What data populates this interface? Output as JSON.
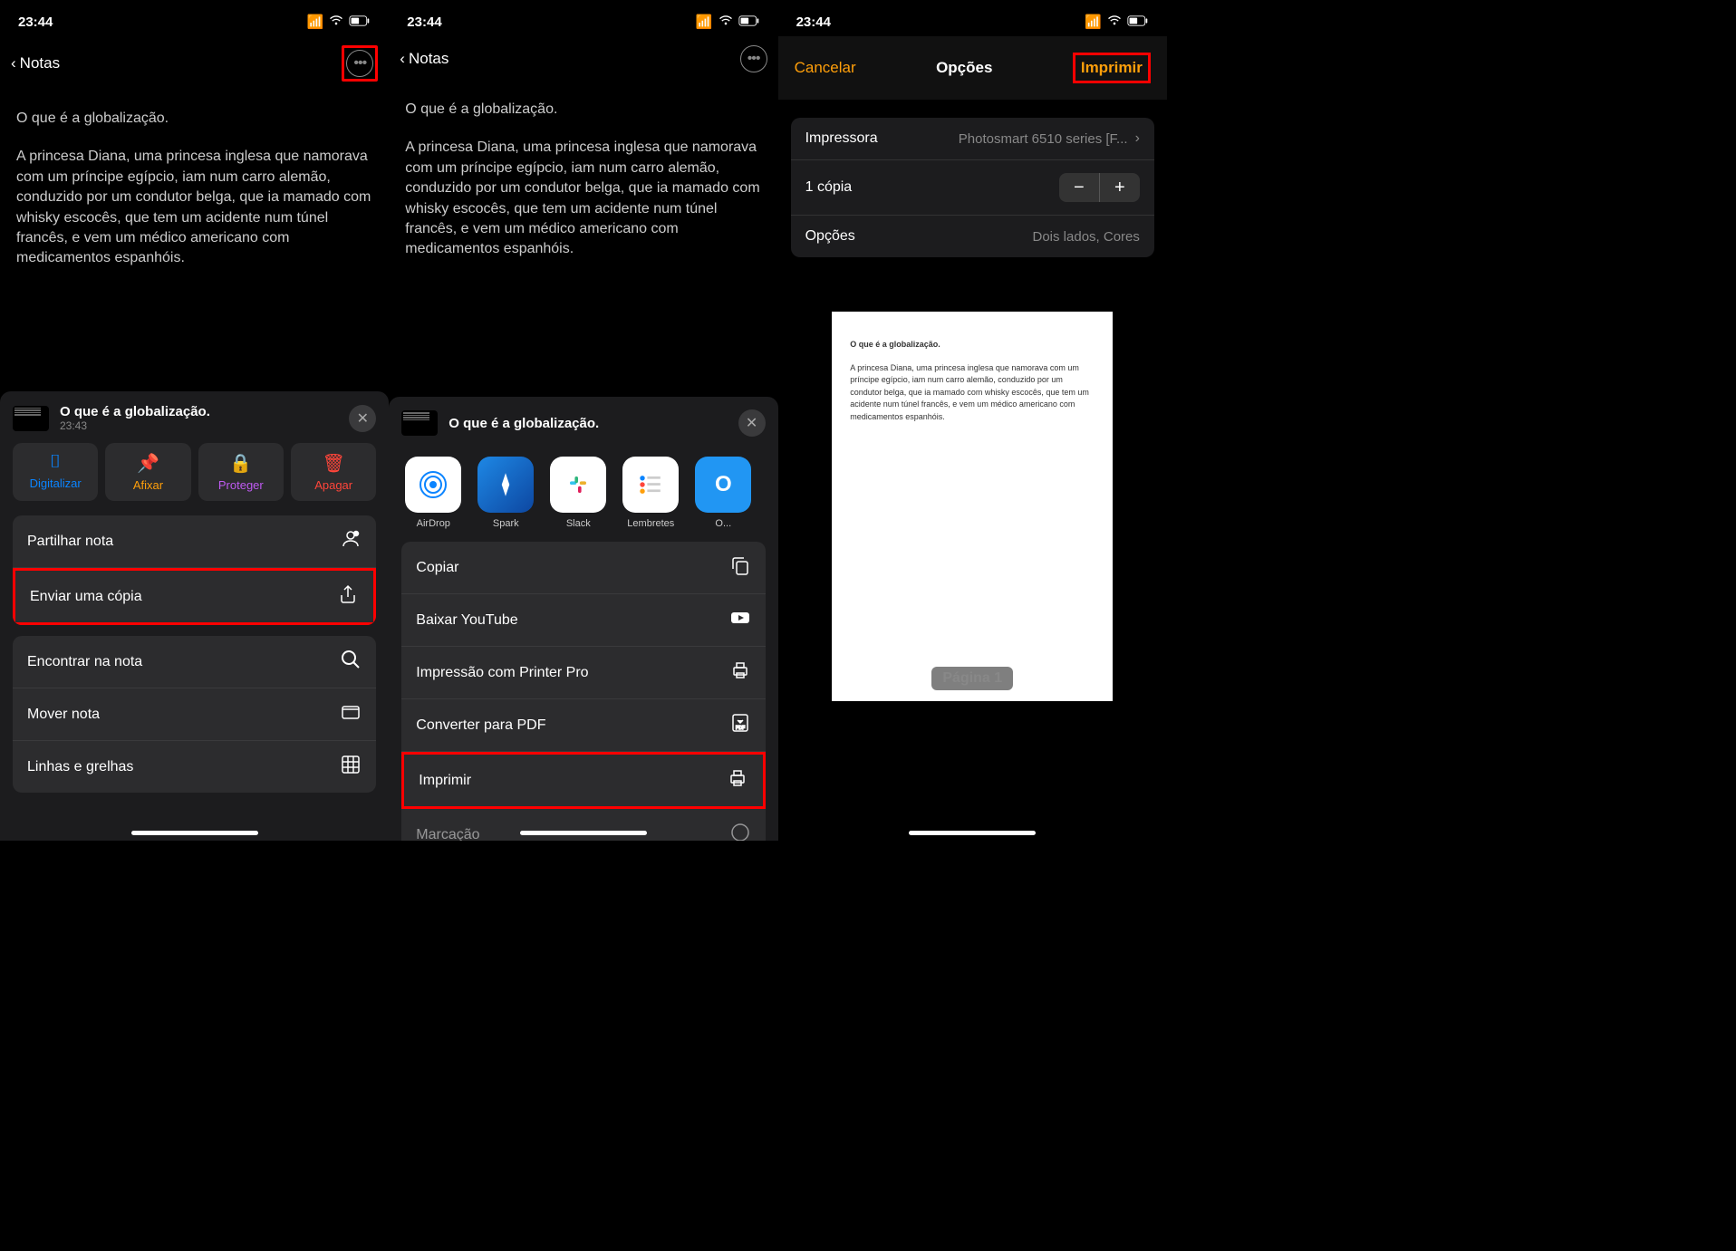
{
  "status_time": "23:44",
  "back_label": "Notas",
  "note": {
    "title": "O que é a globalização.",
    "body": "A princesa Diana, uma princesa inglesa que namorava com um príncipe egípcio, iam num carro alemão, conduzido por um condutor belga, que ia mamado com whisky escocês, que tem um acidente num túnel francês, e vem um médico americano com medicamentos espanhóis."
  },
  "sheet1": {
    "title": "O que é a globalização.",
    "time": "23:43",
    "quick": {
      "scan": "Digitalizar",
      "pin": "Afixar",
      "lock": "Proteger",
      "delete": "Apagar"
    },
    "actions": {
      "share": "Partilhar nota",
      "send_copy": "Enviar uma cópia",
      "find": "Encontrar na nota",
      "move": "Mover nota",
      "lines": "Linhas e grelhas"
    }
  },
  "sheet2": {
    "title": "O que é a globalização.",
    "apps": {
      "airdrop": "AirDrop",
      "spark": "Spark",
      "slack": "Slack",
      "lembretes": "Lembretes",
      "other": "O..."
    },
    "actions": {
      "copy": "Copiar",
      "youtube": "Baixar YouTube",
      "printer_pro": "Impressão com Printer Pro",
      "pdf": "Converter para PDF",
      "print": "Imprimir",
      "mark": "Marcação"
    }
  },
  "print": {
    "cancel": "Cancelar",
    "title": "Opções",
    "action": "Imprimir",
    "printer_label": "Impressora",
    "printer_value": "Photosmart 6510 series [F...",
    "copies": "1 cópia",
    "options_label": "Opções",
    "options_value": "Dois lados, Cores",
    "page_label": "Página 1",
    "preview_title": "O que é a globalização.",
    "preview_body": "A princesa Diana, uma princesa inglesa que namorava com um príncipe egípcio, iam num carro alemão, conduzido por um condutor belga, que ia mamado com whisky escocês, que tem um acidente num túnel francês, e vem um médico americano com medicamentos espanhóis."
  }
}
